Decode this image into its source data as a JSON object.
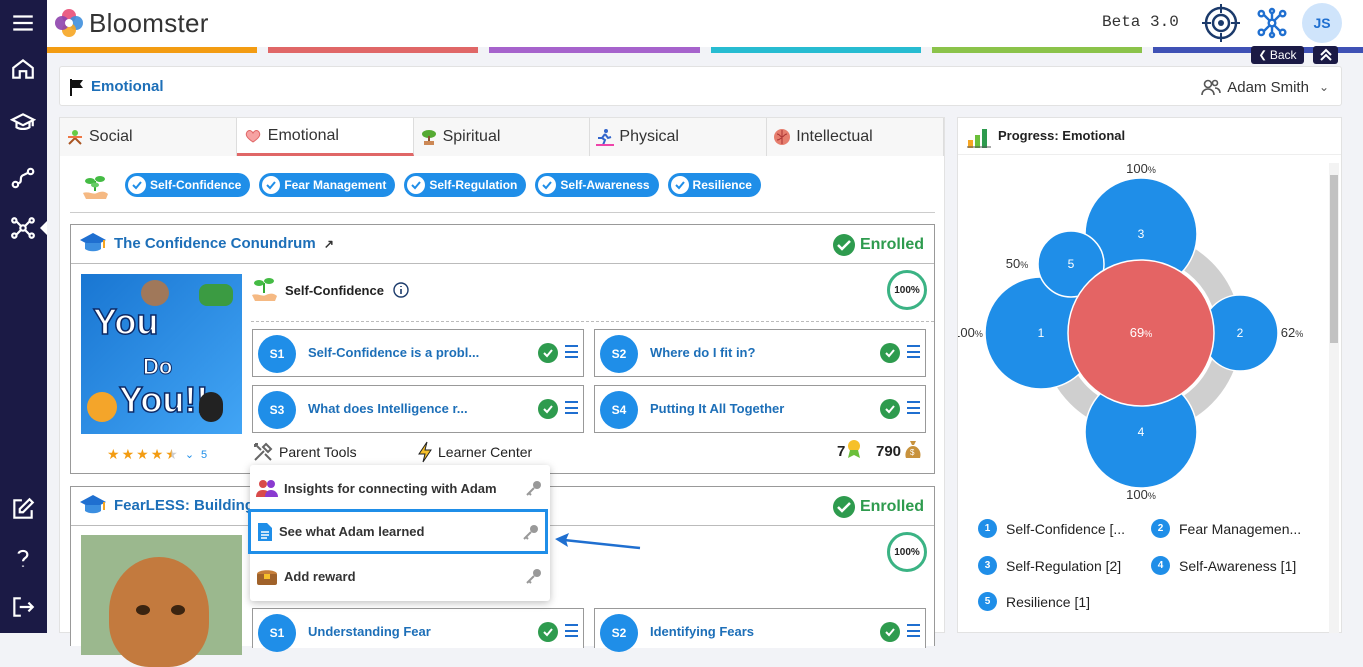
{
  "app": {
    "name": "Bloomster",
    "version": "Beta 3.0",
    "user_initials": "JS"
  },
  "colors": {
    "sidebar": "#1b1a45",
    "accent": "#1f8ee8",
    "link": "#1d6fb8",
    "green": "#2e9b4e",
    "emotional": "#e06767",
    "stripe": [
      "#f39c12",
      "#e06767",
      "#a663cc",
      "#27bcd1",
      "#8bc34a",
      "#3f51b5"
    ]
  },
  "sidebar": {
    "items": [
      "menu-icon",
      "home-icon",
      "graduation-cap-icon",
      "route-icon",
      "network-icon",
      "edit-icon",
      "help-icon",
      "logout-icon"
    ]
  },
  "nav": {
    "back_label": "Back"
  },
  "header": {
    "title": "Emotional",
    "user": "Adam Smith"
  },
  "tabs": [
    {
      "label": "Social"
    },
    {
      "label": "Emotional"
    },
    {
      "label": "Spiritual"
    },
    {
      "label": "Physical"
    },
    {
      "label": "Intellectual"
    }
  ],
  "skills": [
    "Self-Confidence",
    "Fear Management",
    "Self-Regulation",
    "Self-Awareness",
    "Resilience"
  ],
  "courses": [
    {
      "title": "The Confidence Conundrum",
      "status": "Enrolled",
      "skill": "Self-Confidence",
      "progress": "100%",
      "thumbnail_text": [
        "You",
        "Do",
        "You!!"
      ],
      "rating_count": "5",
      "rating_stars": 4.5,
      "lessons": [
        {
          "badge": "S1",
          "title": "Self-Confidence is a probl..."
        },
        {
          "badge": "S2",
          "title": "Where do I fit in?"
        },
        {
          "badge": "S3",
          "title": "What does Intelligence r..."
        },
        {
          "badge": "S4",
          "title": "Putting It All Together"
        }
      ],
      "tools": {
        "parent": "Parent Tools",
        "learner": "Learner Center"
      },
      "stats": {
        "awards": "7",
        "coins": "790"
      }
    },
    {
      "title": "FearLESS: Building B",
      "status": "Enrolled",
      "progress": "100%",
      "lessons": [
        {
          "badge": "S1",
          "title": "Understanding Fear"
        },
        {
          "badge": "S2",
          "title": "Identifying Fears"
        }
      ]
    }
  ],
  "parent_menu": [
    {
      "label": "Insights for connecting with Adam",
      "icon": "people-icon"
    },
    {
      "label": "See what Adam learned",
      "icon": "document-icon"
    },
    {
      "label": "Add reward",
      "icon": "treasure-chest-icon"
    }
  ],
  "progress": {
    "title": "Progress: Emotional",
    "center": {
      "value": "69",
      "unit": "%"
    },
    "nodes": [
      {
        "n": "1",
        "label": "100",
        "unit": "%",
        "value": 100
      },
      {
        "n": "2",
        "label": "62",
        "unit": "%",
        "value": 62
      },
      {
        "n": "3",
        "label": "100",
        "unit": "%",
        "value": 100
      },
      {
        "n": "4",
        "label": "100",
        "unit": "%",
        "value": 100
      },
      {
        "n": "5",
        "label": "50",
        "unit": "%",
        "value": 50
      }
    ],
    "legend": [
      {
        "n": "1",
        "label": "Self-Confidence [..."
      },
      {
        "n": "2",
        "label": "Fear Managemen..."
      },
      {
        "n": "3",
        "label": "Self-Regulation [2]"
      },
      {
        "n": "4",
        "label": "Self-Awareness [1]"
      },
      {
        "n": "5",
        "label": "Resilience [1]"
      }
    ]
  }
}
